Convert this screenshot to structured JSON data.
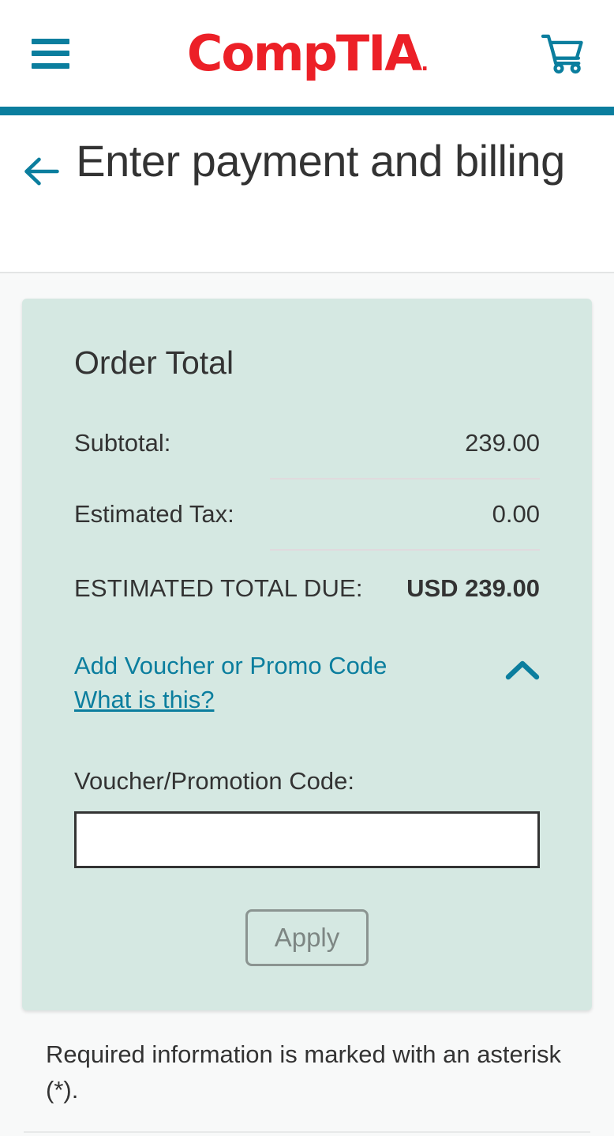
{
  "header": {
    "menu_icon": "hamburger-menu-icon",
    "logo_text": "CompTIA",
    "logo_registered_mark": ".",
    "logo_color": "#ec2027",
    "cart_icon": "shopping-cart-icon",
    "accent_color": "#0b7e9e"
  },
  "title_bar": {
    "back_icon": "back-arrow-icon",
    "title": "Enter payment and billing"
  },
  "order_card": {
    "heading": "Order Total",
    "background_color": "#d5e8e2",
    "rows": [
      {
        "label": "Subtotal:",
        "value": "239.00"
      },
      {
        "label": "Estimated Tax:",
        "value": "0.00"
      }
    ],
    "grand_total": {
      "label": "ESTIMATED TOTAL DUE:",
      "value": "USD 239.00"
    },
    "voucher": {
      "toggle_label": "Add Voucher or Promo Code",
      "help_label": "What is this?",
      "chevron_icon": "chevron-up-icon",
      "field_label": "Voucher/Promotion Code:",
      "field_value": "",
      "field_placeholder": "",
      "apply_label": "Apply"
    }
  },
  "footer": {
    "required_note": "Required information is marked with an asterisk (*)."
  }
}
